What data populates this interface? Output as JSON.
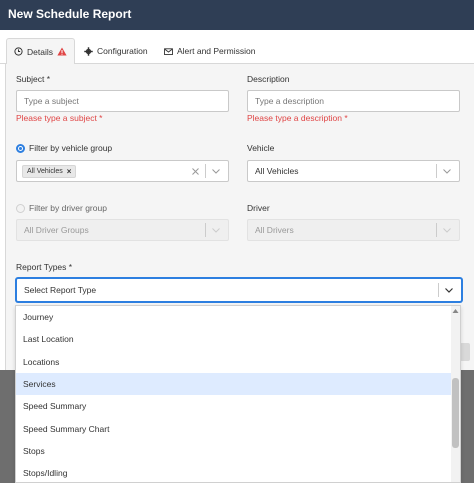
{
  "dialog": {
    "title": "New Schedule Report"
  },
  "tabs": [
    {
      "label": "Details",
      "icon": "clock-icon",
      "warning_icon": "warning-icon"
    },
    {
      "label": "Configuration",
      "icon": "gear-icon"
    },
    {
      "label": "Alert and Permission",
      "icon": "mail-icon"
    }
  ],
  "form": {
    "subject": {
      "label": "Subject *",
      "placeholder": "Type a subject",
      "error": "Please type a subject *"
    },
    "description": {
      "label": "Description",
      "placeholder": "Type a description",
      "error": "Please type a description *"
    },
    "filter_vehicle": {
      "label": "Filter by vehicle group",
      "tag": "All Vehicles",
      "selected": true
    },
    "vehicle": {
      "label": "Vehicle",
      "value": "All Vehicles"
    },
    "filter_driver": {
      "label": "Filter by driver group",
      "value": "All Driver Groups",
      "selected": false
    },
    "driver": {
      "label": "Driver",
      "value": "All Drivers"
    },
    "report_types": {
      "label": "Report Types *",
      "placeholder": "Select Report Type"
    }
  },
  "dropdown": {
    "options": [
      "Journey",
      "Last Location",
      "Locations",
      "Services",
      "Speed Summary",
      "Speed Summary Chart",
      "Stops",
      "Stops/Idling"
    ],
    "highlighted": "Services"
  },
  "colors": {
    "header": "#2f3e55",
    "error": "#e04545",
    "accent": "#2d7fe0",
    "highlight": "#deebff"
  }
}
